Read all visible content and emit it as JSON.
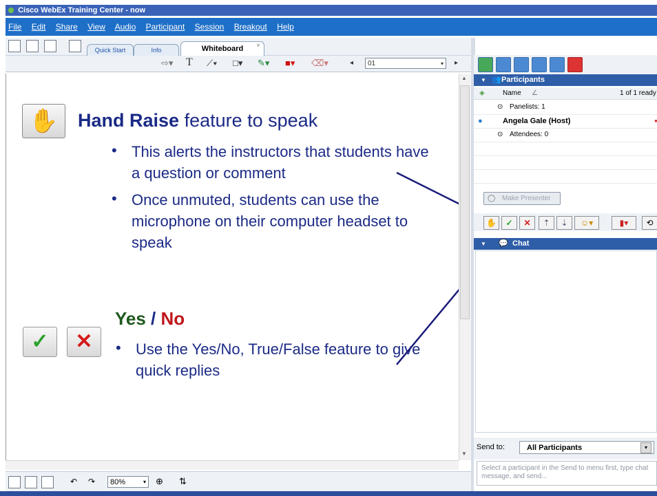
{
  "window": {
    "title": "Cisco WebEx Training Center - now"
  },
  "menu": [
    "File",
    "Edit",
    "Share",
    "View",
    "Audio",
    "Participant",
    "Session",
    "Breakout",
    "Help"
  ],
  "tabs": [
    {
      "label": "Quick Start"
    },
    {
      "label": "Info"
    },
    {
      "label": "Whiteboard",
      "active": true,
      "close": "×"
    }
  ],
  "whiteboard_toolbar": {
    "page_value": "01",
    "text_tool": "T"
  },
  "slide": {
    "hand_heading_bold": "Hand Raise",
    "hand_heading_rest": " feature to speak",
    "hand_bullets": [
      "This alerts the instructors that students have a question or comment",
      "Once unmuted, students can use the microphone on their computer headset to speak"
    ],
    "yes_label": "Yes",
    "slash": " / ",
    "no_label": "No",
    "yesno_bullets": [
      "Use the Yes/No, True/False feature to give quick replies"
    ],
    "bullet_char": "•",
    "colors": {
      "text": "#1b2a86",
      "yes": "#1f5a1f",
      "no": "#c0171c",
      "arrow": "#1a1a7a"
    }
  },
  "participants": {
    "header": "Participants",
    "name_col": "Name",
    "count": "1 of 1 ready",
    "panelists": "Panelists: 1",
    "host": "Angela Gale (Host)",
    "attendees": "Attendees: 0",
    "make_presenter": "Make Presenter"
  },
  "chat": {
    "header": "Chat",
    "send_to_label": "Send to:",
    "send_to_value": "All Participants",
    "placeholder": "Select a participant in the Send to menu first, type chat message, and send..."
  },
  "bottom_toolbar": {
    "zoom": "80%"
  }
}
